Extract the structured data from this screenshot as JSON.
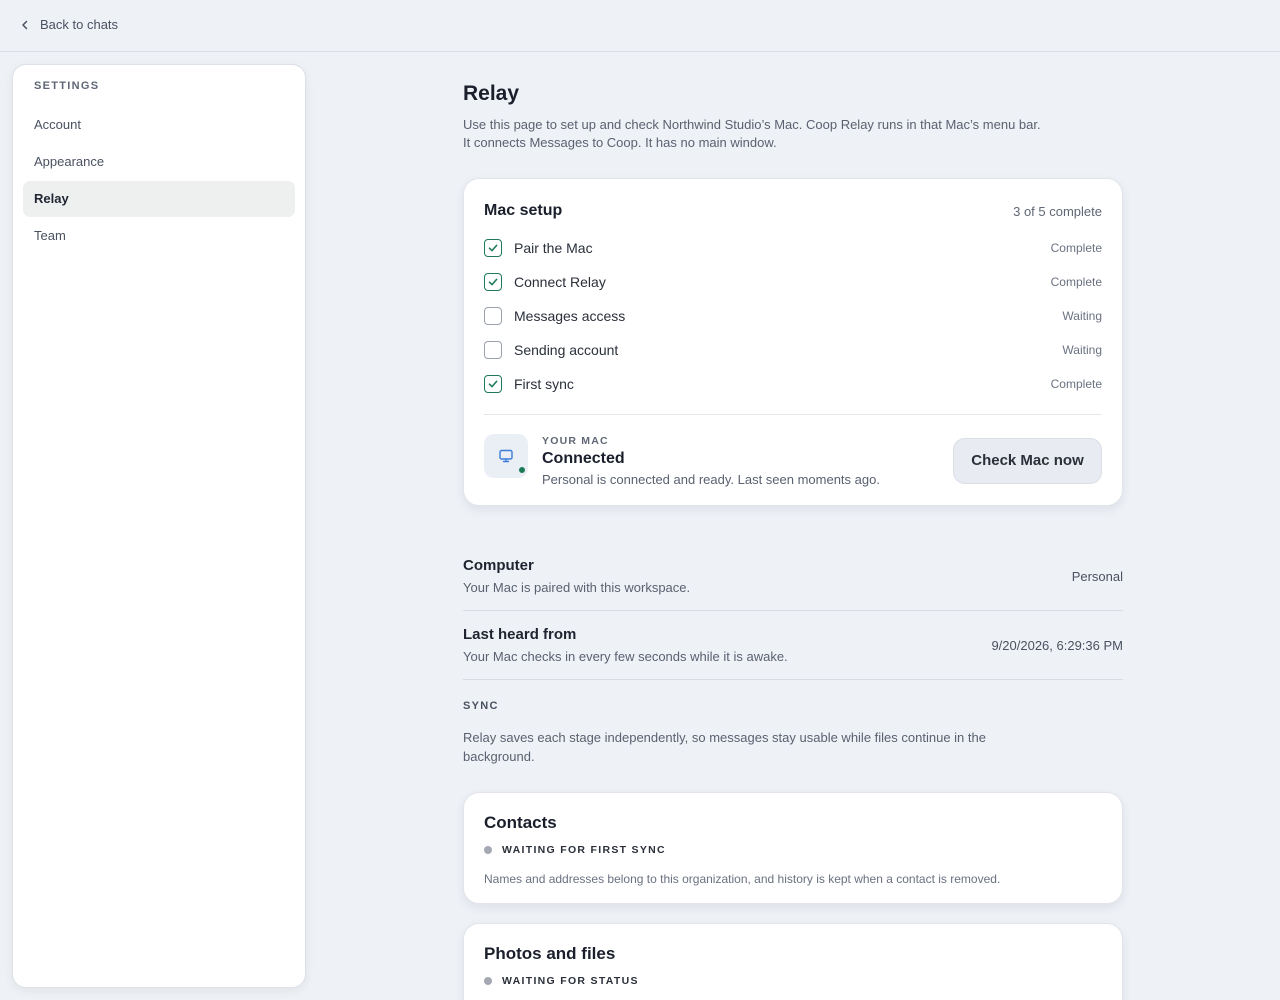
{
  "topbar": {
    "back_label": "Back to chats"
  },
  "sidebar": {
    "heading": "SETTINGS",
    "items": [
      {
        "label": "Account",
        "active": false
      },
      {
        "label": "Appearance",
        "active": false
      },
      {
        "label": "Relay",
        "active": true
      },
      {
        "label": "Team",
        "active": false
      }
    ]
  },
  "main": {
    "title": "Relay",
    "description_line1": "Use this page to set up and check Northwind Studio’s Mac. Coop Relay runs in that Mac’s menu bar.",
    "description_line2": "It connects Messages to Coop. It has no main window."
  },
  "setup": {
    "title": "Mac setup",
    "progress": {
      "text": "3 of 5 complete",
      "completed": 3,
      "total": 5
    },
    "steps": [
      {
        "label": "Pair the Mac",
        "status": "Complete",
        "checked": true
      },
      {
        "label": "Connect Relay",
        "status": "Complete",
        "checked": true
      },
      {
        "label": "Messages access",
        "status": "Waiting",
        "checked": false
      },
      {
        "label": "Sending account",
        "status": "Waiting",
        "checked": false
      },
      {
        "label": "First sync",
        "status": "Complete",
        "checked": true
      }
    ],
    "mac": {
      "eyebrow": "YOUR MAC",
      "state": "Connected",
      "detail": "Personal is connected and ready. Last seen moments ago.",
      "button_label": "Check Mac now"
    }
  },
  "info": {
    "computer": {
      "title": "Computer",
      "description": "Your Mac is paired with this workspace.",
      "value": "Personal"
    },
    "last_heard": {
      "title": "Last heard from",
      "description": "Your Mac checks in every few seconds while it is awake.",
      "value": "9/20/2026, 6:29:36 PM"
    }
  },
  "sync": {
    "heading": "SYNC",
    "description": "Relay saves each stage independently, so messages stay usable while files continue in the background.",
    "cards": [
      {
        "title": "Contacts",
        "status": "WAITING FOR FIRST SYNC",
        "description": "Names and addresses belong to this organization, and history is kept when a contact is removed."
      },
      {
        "title": "Photos and files",
        "status": "WAITING FOR STATUS"
      }
    ]
  },
  "colors": {
    "accent_green": "#1f7a5a",
    "icon_blue": "#3b7dd8",
    "status_gray": "#a3a8b2"
  }
}
